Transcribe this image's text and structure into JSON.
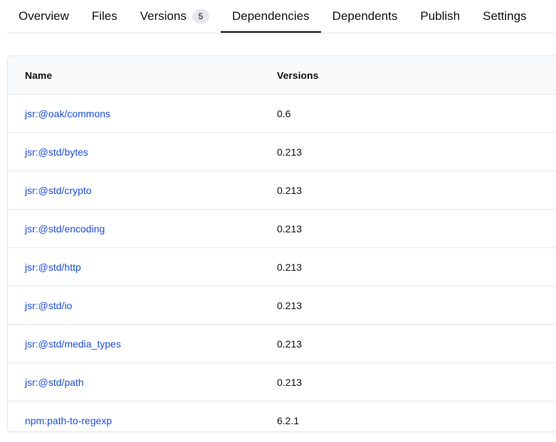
{
  "tabs": [
    {
      "label": "Overview",
      "active": false
    },
    {
      "label": "Files",
      "active": false
    },
    {
      "label": "Versions",
      "active": false,
      "count": "5"
    },
    {
      "label": "Dependencies",
      "active": true
    },
    {
      "label": "Dependents",
      "active": false
    },
    {
      "label": "Publish",
      "active": false
    },
    {
      "label": "Settings",
      "active": false
    }
  ],
  "table": {
    "headers": {
      "name": "Name",
      "versions": "Versions"
    },
    "rows": [
      {
        "name": "jsr:@oak/commons",
        "version": "0.6"
      },
      {
        "name": "jsr:@std/bytes",
        "version": "0.213"
      },
      {
        "name": "jsr:@std/crypto",
        "version": "0.213"
      },
      {
        "name": "jsr:@std/encoding",
        "version": "0.213"
      },
      {
        "name": "jsr:@std/http",
        "version": "0.213"
      },
      {
        "name": "jsr:@std/io",
        "version": "0.213"
      },
      {
        "name": "jsr:@std/media_types",
        "version": "0.213"
      },
      {
        "name": "jsr:@std/path",
        "version": "0.213"
      },
      {
        "name": "npm:path-to-regexp",
        "version": "6.2.1"
      }
    ]
  },
  "colors": {
    "link": "#1d4ed8",
    "border": "#e5e7eb",
    "header_bg": "#f9fafb",
    "badge_bg": "#e5e7eb"
  }
}
